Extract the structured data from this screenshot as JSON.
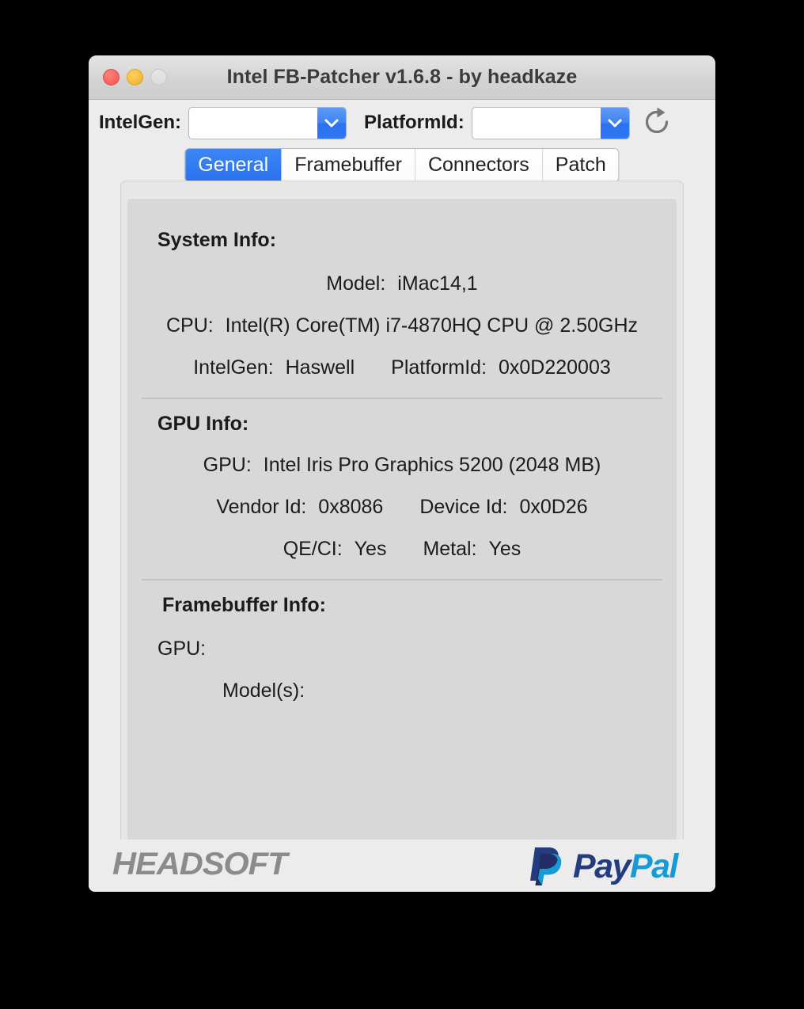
{
  "window": {
    "title": "Intel FB-Patcher v1.6.8 - by headkaze",
    "traffic_lights": [
      "close-button",
      "minimize-button",
      "zoom-button"
    ]
  },
  "toolbar": {
    "intelgen_label": "IntelGen:",
    "intelgen_value": "",
    "intelgen_placeholder": "",
    "platformid_label": "PlatformId:",
    "platformid_value": "",
    "platformid_placeholder": "",
    "refresh_icon": "refresh-icon"
  },
  "tabs": [
    {
      "label": "General",
      "active": true
    },
    {
      "label": "Framebuffer",
      "active": false
    },
    {
      "label": "Connectors",
      "active": false
    },
    {
      "label": "Patch",
      "active": false
    }
  ],
  "general": {
    "system_info": {
      "heading": "System Info:",
      "model_label": "Model:",
      "model_value": "iMac14,1",
      "cpu_label": "CPU:",
      "cpu_value": "Intel(R) Core(TM) i7-4870HQ CPU @ 2.50GHz",
      "intelgen_label": "IntelGen:",
      "intelgen_value": "Haswell",
      "platformid_label": "PlatformId:",
      "platformid_value": "0x0D220003"
    },
    "gpu_info": {
      "heading": "GPU Info:",
      "gpu_label": "GPU:",
      "gpu_value": "Intel Iris Pro Graphics 5200 (2048 MB)",
      "vendor_label": "Vendor Id:",
      "vendor_value": "0x8086",
      "device_label": "Device Id:",
      "device_value": "0x0D26",
      "qeci_label": "QE/CI:",
      "qeci_value": "Yes",
      "metal_label": "Metal:",
      "metal_value": "Yes"
    },
    "framebuffer_info": {
      "heading": "Framebuffer Info:",
      "gpu_label": "GPU:",
      "gpu_value": "",
      "models_label": "Model(s):",
      "models_value": ""
    }
  },
  "segmented_toolbar": [
    {
      "name": "gear-icon",
      "active": true
    },
    {
      "name": "kext-package-icon",
      "active": false
    },
    {
      "name": "memory-chip-icon",
      "active": false
    },
    {
      "name": "speaker-icon",
      "active": false
    },
    {
      "name": "usb-icon",
      "active": false
    }
  ],
  "footer": {
    "brand": "HEADSOFT",
    "paypal_pay": "Pay",
    "paypal_pal": "Pal",
    "paypal_icon": "paypal-logo-icon"
  },
  "colors": {
    "accent_blue": "#2f78f1",
    "window_chrome": "#ececec",
    "panel_bg": "#d8d8d8",
    "paypal_dark": "#253b80",
    "paypal_light": "#179bd7",
    "brand_gray": "#8b8b8b"
  }
}
